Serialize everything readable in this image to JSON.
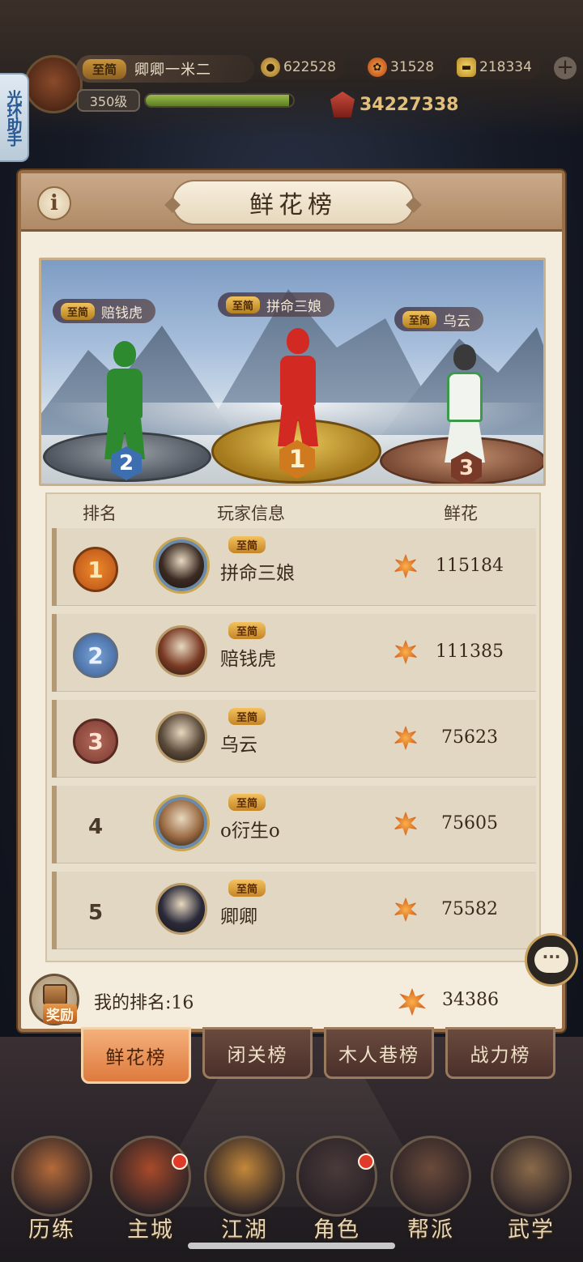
{
  "header": {
    "vip_tag": "至简",
    "player_name": "卿卿一米二",
    "level": "350级",
    "exp_progress": 0.97,
    "resources": [
      {
        "icon": "coin-icon",
        "value": "622528"
      },
      {
        "icon": "flower-icon",
        "value": "31528"
      },
      {
        "icon": "ingot-icon",
        "value": "218334"
      }
    ],
    "power_value": "34227338"
  },
  "halo_assistant": "光环助手",
  "panel": {
    "title": "鲜花榜",
    "info_icon": "i"
  },
  "podium": [
    {
      "rank": "2",
      "vip": "至简",
      "name": "赔钱虎",
      "outfit_color": "#2e8a2e"
    },
    {
      "rank": "1",
      "vip": "至简",
      "name": "拼命三娘",
      "outfit_color": "#d22a22"
    },
    {
      "rank": "3",
      "vip": "至简",
      "name": "乌云",
      "outfit_color": "#f2f4f0"
    }
  ],
  "table": {
    "headers": {
      "rank": "排名",
      "info": "玩家信息",
      "flowers": "鲜花"
    },
    "rows": [
      {
        "rank": "1",
        "vip": "至简",
        "name": "拼命三娘",
        "flowers": "115184",
        "avatar_color": "#3a2a22"
      },
      {
        "rank": "2",
        "vip": "至简",
        "name": "赔钱虎",
        "flowers": "111385",
        "avatar_color": "#7a3a24"
      },
      {
        "rank": "3",
        "vip": "至简",
        "name": "乌云",
        "flowers": "75623",
        "avatar_color": "#5a4a3a"
      },
      {
        "rank": "4",
        "vip": "至简",
        "name": "o衍生o",
        "flowers": "75605",
        "avatar_color": "#9a6a42"
      },
      {
        "rank": "5",
        "vip": "至简",
        "name": "卿卿",
        "flowers": "75582",
        "avatar_color": "#2a2a3a"
      }
    ]
  },
  "my_rank": {
    "reward_label": "奖励",
    "text": "我的排名:16",
    "flowers": "34386"
  },
  "chat_icon": "···",
  "tabs": [
    {
      "label": "鲜花榜",
      "active": true
    },
    {
      "label": "闭关榜",
      "active": false
    },
    {
      "label": "木人巷榜",
      "active": false
    },
    {
      "label": "战力榜",
      "active": false
    }
  ],
  "nav": [
    {
      "label": "历练",
      "icon": "scroll-icon",
      "color": "#b46a3a",
      "badge": false
    },
    {
      "label": "主城",
      "icon": "city-gate-icon",
      "color": "#a84a2a",
      "badge": true
    },
    {
      "label": "江湖",
      "icon": "sword-icon",
      "color": "#c4883a",
      "badge": false
    },
    {
      "label": "角色",
      "icon": "character-icon",
      "color": "#4a3a3a",
      "badge": true
    },
    {
      "label": "帮派",
      "icon": "clan-icon",
      "color": "#6a4a3a",
      "badge": false
    },
    {
      "label": "武学",
      "icon": "books-icon",
      "color": "#8a6a4a",
      "badge": false
    }
  ]
}
